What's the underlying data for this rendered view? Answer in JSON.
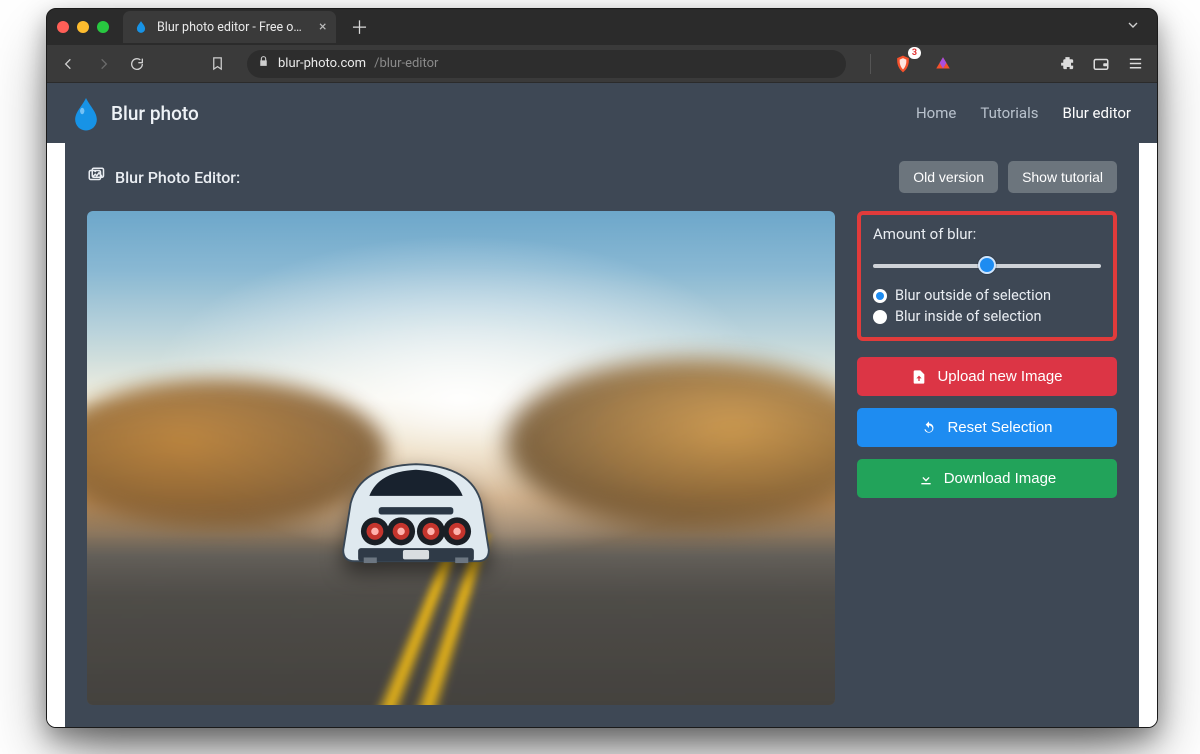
{
  "browser": {
    "tab_title": "Blur photo editor - Free online t",
    "url_domain": "blur-photo.com",
    "url_path": "/blur-editor",
    "shield_badge": "3"
  },
  "header": {
    "brand": "Blur photo",
    "nav": {
      "home": "Home",
      "tutorials": "Tutorials",
      "editor": "Blur editor"
    }
  },
  "panel": {
    "title": "Blur Photo Editor:",
    "old_version": "Old version",
    "show_tutorial": "Show tutorial"
  },
  "controls": {
    "amount_label": "Amount of blur:",
    "slider_percent": 50,
    "radio_outside": "Blur outside of selection",
    "radio_inside": "Blur inside of selection",
    "radio_selected": "outside",
    "upload": "Upload new Image",
    "reset": "Reset Selection",
    "download": "Download Image"
  }
}
